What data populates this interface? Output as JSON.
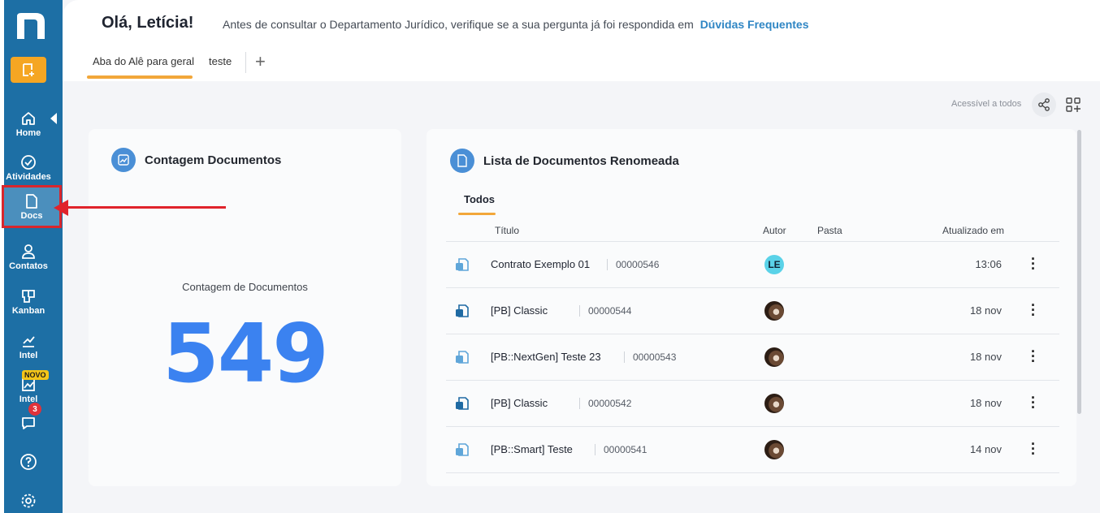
{
  "sidebar": {
    "items": [
      {
        "label": "Home",
        "icon": "home-icon"
      },
      {
        "label": "Atividades",
        "icon": "check-circle-icon"
      },
      {
        "label": "Docs",
        "icon": "document-icon"
      },
      {
        "label": "Contatos",
        "icon": "user-icon"
      },
      {
        "label": "Kanban",
        "icon": "kanban-icon"
      },
      {
        "label": "Intel",
        "icon": "chart-line-icon"
      },
      {
        "label": "Intel",
        "icon": "chart-image-icon",
        "badge": "NOVO"
      }
    ],
    "chat_badge": "3"
  },
  "header": {
    "greeting": "Olá, Letícia!",
    "notice": "Antes de consultar o Departamento Jurídico, verifique se a sua pergunta já foi respondida em",
    "notice_link": "Dúvidas Frequentes",
    "tabs": [
      {
        "label": "Aba do Alê para geral"
      },
      {
        "label": "teste"
      }
    ],
    "add_tab": "+"
  },
  "toolbar": {
    "access_label": "Acessível a todos"
  },
  "count_card": {
    "title": "Contagem Documentos",
    "label": "Contagem de Documentos",
    "value": "549"
  },
  "list_card": {
    "title": "Lista de Documentos Renomeada",
    "subtab": "Todos",
    "columns": {
      "title": "Título",
      "author": "Autor",
      "folder": "Pasta",
      "updated": "Atualizado em"
    },
    "rows": [
      {
        "title": "Contrato Exemplo 01",
        "code": "00000546",
        "author": "LE",
        "time": "13:06",
        "icon_color": "#5fa6d9"
      },
      {
        "title": "[PB] Classic",
        "code": "00000544",
        "author": "",
        "time": "18 nov",
        "icon_color": "#1f6aa3"
      },
      {
        "title": "[PB::NextGen] Teste 23",
        "code": "00000543",
        "author": "",
        "time": "18 nov",
        "icon_color": "#5fa6d9"
      },
      {
        "title": "[PB] Classic",
        "code": "00000542",
        "author": "",
        "time": "18 nov",
        "icon_color": "#1f6aa3"
      },
      {
        "title": "[PB::Smart] Teste",
        "code": "00000541",
        "author": "",
        "time": "14 nov",
        "icon_color": "#5fa6d9"
      }
    ]
  },
  "colors": {
    "sidebar": "#1d6fa5",
    "accent": "#f2a73a",
    "count": "#3b82f0",
    "highlight": "#e0232b"
  }
}
